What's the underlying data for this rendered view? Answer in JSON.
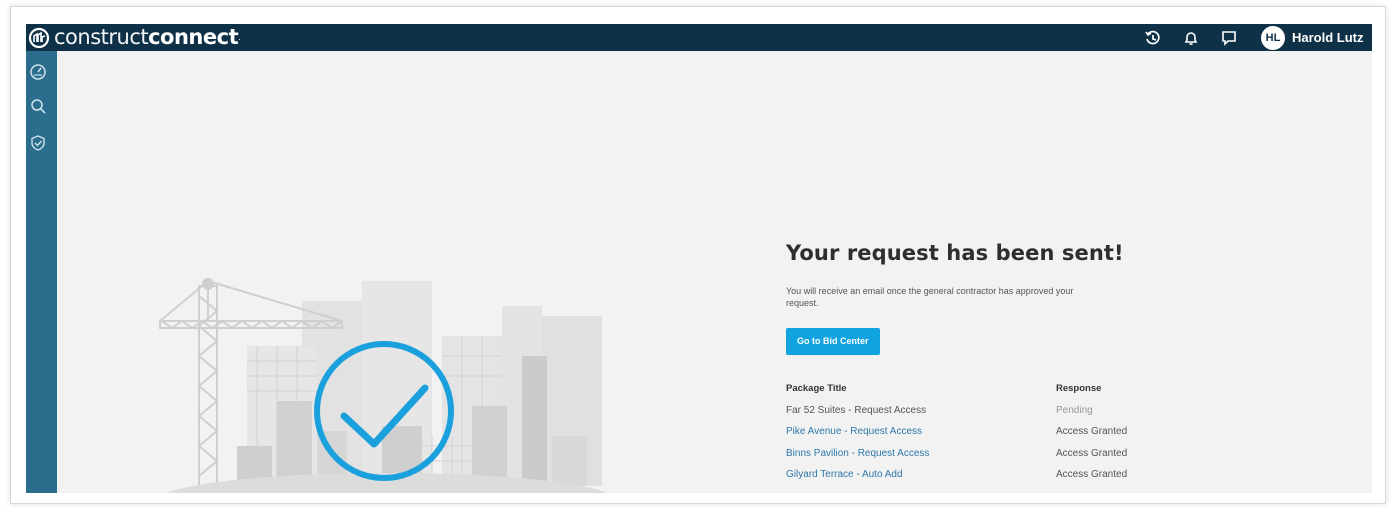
{
  "header": {
    "logo_light": "construct",
    "logo_bold": "connect",
    "logo_tm": ".",
    "avatar_initials": "HL",
    "user_name": "Harold Lutz"
  },
  "main": {
    "title": "Your request has been sent!",
    "message": "You will receive an email once the general contractor has approved your request.",
    "cta_label": "Go to Bid Center",
    "table": {
      "headers": [
        "Package Title",
        "Response"
      ],
      "rows": [
        {
          "title": "Far 52 Suites - Request Access",
          "response": "Pending"
        },
        {
          "title": "Pike Avenue - Request Access",
          "response": "Access Granted"
        },
        {
          "title": "Binns Pavilion - Request Access",
          "response": "Access Granted"
        },
        {
          "title": "Gilyard Terrace - Auto Add",
          "response": "Access Granted"
        }
      ]
    }
  },
  "colors": {
    "topbar": "#0f3147",
    "sidebar": "#2b6d8c",
    "accent": "#0fa3e0",
    "link": "#2e78a8"
  },
  "icons": [
    "logo-mark-icon",
    "history-icon",
    "bell-icon",
    "chat-icon",
    "dashboard-icon",
    "search-icon",
    "shield-check-icon",
    "checkmark-circle-icon"
  ]
}
